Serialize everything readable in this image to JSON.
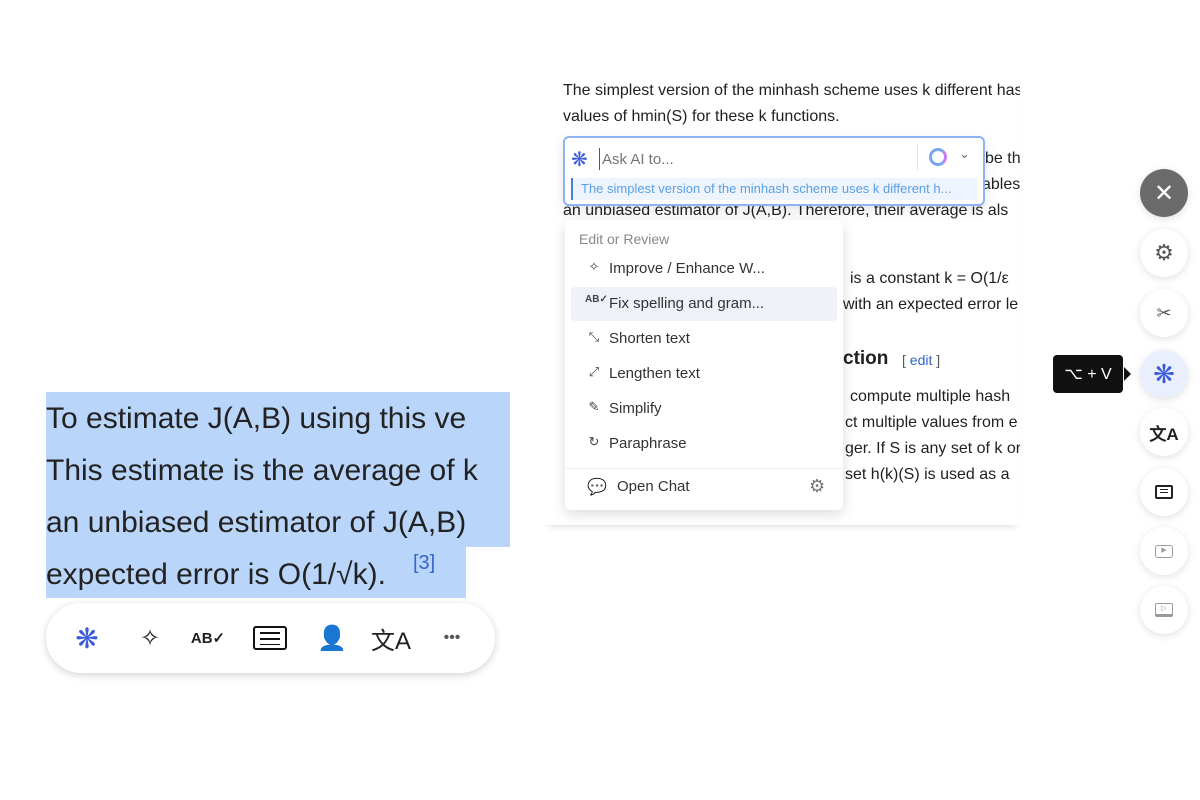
{
  "doc": {
    "line1": "The simplest version of the minhash scheme uses k different hash",
    "line2": "values of hmin(S) for these k functions.",
    "frag_be": "be th",
    "frag_ables": "ables",
    "frag_unbiased": "an unbiased estimator of J(A,B). Therefore, their average is als",
    "frag_const": "is a constant k = O(1/ε",
    "frag_err": "with an expected error le",
    "heading_frag": "ction",
    "edit": "edit",
    "frag_compute": "compute multiple hash",
    "frag_values": "ct multiple values from e",
    "frag_if": "ger. If S is any set of k or",
    "frag_subset": "set h(k)(S) is used as a"
  },
  "ask": {
    "placeholder": "Ask AI to...",
    "quote": "The simplest version of the minhash scheme uses k different h..."
  },
  "menu": {
    "section": "Edit or Review",
    "items": [
      {
        "label": "Improve / Enhance W...",
        "icon": "magic-wand-icon"
      },
      {
        "label": "Fix spelling and gram...",
        "icon": "spellcheck-icon"
      },
      {
        "label": "Shorten text",
        "icon": "shrink-icon"
      },
      {
        "label": "Lengthen text",
        "icon": "expand-icon"
      },
      {
        "label": "Simplify",
        "icon": "feather-icon"
      },
      {
        "label": "Paraphrase",
        "icon": "refresh-icon"
      }
    ],
    "open_chat": "Open Chat"
  },
  "selection": {
    "l1": "To estimate J(A,B) using this ve",
    "l2": "This estimate is the average of k",
    "l3": "an unbiased estimator of J(A,B)",
    "l4": "expected error is O(1/√k).",
    "ref": "[3]"
  },
  "toolbar": {
    "more": "•••"
  },
  "tooltip": "⌥ + V",
  "colors": {
    "accent": "#3b5bdb",
    "selection": "#b9d5fa",
    "close": "#6b6b6b"
  }
}
